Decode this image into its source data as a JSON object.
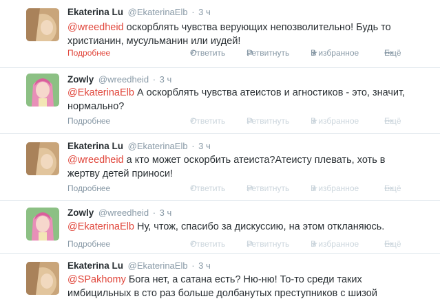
{
  "actions": {
    "more": "Подробнее",
    "reply": "Ответить",
    "retweet": "Ретвитнуть",
    "favorite": "В избранное",
    "more_menu": "Ещё"
  },
  "tweets": [
    {
      "name": "Ekaterina Lu",
      "handle": "@EkaterinaElb",
      "time": "3 ч",
      "mention": "@wreedheid",
      "line1": " оскорблять чувства верующих непозволительно! Будь то",
      "line2": "христианин, мусульманин или иудей!"
    },
    {
      "name": "Zowly",
      "handle": "@wreedheid",
      "time": "3 ч",
      "mention": "@EkaterinaElb",
      "line1": " А оскорблять чувства атеистов и агностиков - это, значит,",
      "line2": "нормально?"
    },
    {
      "name": "Ekaterina Lu",
      "handle": "@EkaterinaElb",
      "time": "3 ч",
      "mention": "@wreedheid",
      "line1": " а кто может оскорбить атеиста?Атеисту плевать, хоть в",
      "line2": "жертву детей приноси!"
    },
    {
      "name": "Zowly",
      "handle": "@wreedheid",
      "time": "3 ч",
      "mention": "@EkaterinaElb",
      "line1": " Ну, чтож, спасибо за дискуссию, на этом откланяюсь.",
      "line2": ""
    },
    {
      "name": "Ekaterina Lu",
      "handle": "@EkaterinaElb",
      "time": "3 ч",
      "mention": "@SPakhomy",
      "line1": " Бога нет, а сатана есть? Ню-ню! То-то среди таких",
      "line2": "имбицильных в сто раз больше долбанутых преступников с шизой"
    }
  ]
}
